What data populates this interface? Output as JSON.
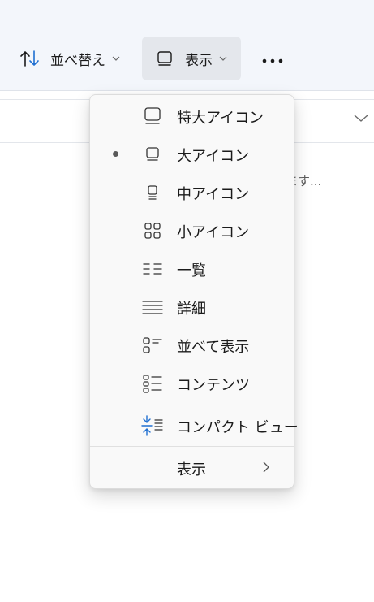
{
  "toolbar": {
    "sort_label": "並べ替え",
    "view_label": "表示",
    "sort_icon": "sort-arrows-icon",
    "view_icon": "large-icons-view-icon",
    "more_icon": "more-horizontal-icon",
    "accent_color": "#1f6fd1"
  },
  "background": {
    "truncated_text": "ます..."
  },
  "view_menu": {
    "items": [
      {
        "label": "特大アイコン",
        "icon": "extra-large-icons-icon",
        "selected": false
      },
      {
        "label": "大アイコン",
        "icon": "large-icons-icon",
        "selected": true
      },
      {
        "label": "中アイコン",
        "icon": "medium-icons-icon",
        "selected": false
      },
      {
        "label": "小アイコン",
        "icon": "small-icons-icon",
        "selected": false
      },
      {
        "label": "一覧",
        "icon": "list-icon",
        "selected": false
      },
      {
        "label": "詳細",
        "icon": "details-icon",
        "selected": false
      },
      {
        "label": "並べて表示",
        "icon": "tiles-icon",
        "selected": false
      },
      {
        "label": "コンテンツ",
        "icon": "content-icon",
        "selected": false
      }
    ],
    "compact_view_label": "コンパクト ビュー",
    "compact_view_icon": "compact-view-icon",
    "show_submenu_label": "表示",
    "show_submenu_icon": "chevron-right-icon"
  }
}
